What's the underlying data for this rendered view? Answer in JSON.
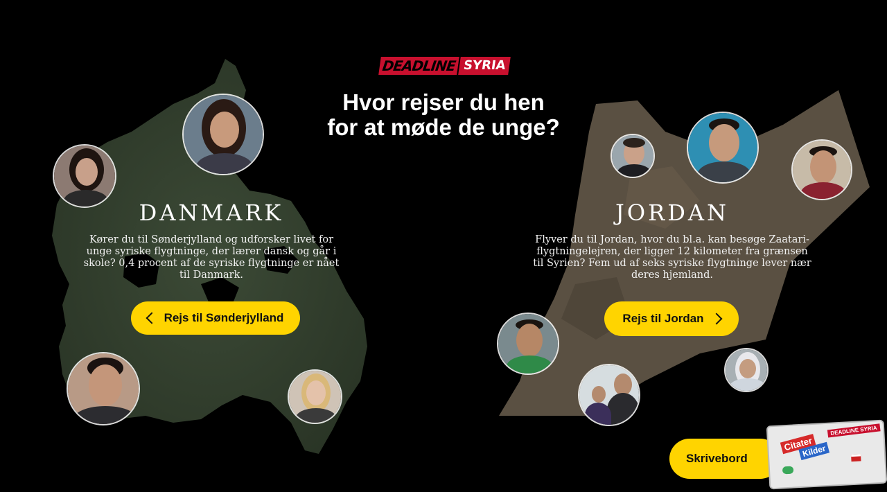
{
  "logo": {
    "part1": "DEADLINE",
    "part2": "SYRIA"
  },
  "headline": {
    "line1": "Hvor rejser du hen",
    "line2": "for at møde de unge?"
  },
  "denmark": {
    "title": "DANMARK",
    "lines": [
      "Kører du til Sønderjylland og udforsker livet for",
      "unge syriske flygtninge, der lærer dansk og går i",
      "skole? 0,4 procent af de syriske flygtninge er nået",
      "til Danmark."
    ],
    "button": "Rejs til Sønderjylland"
  },
  "jordan": {
    "title": "JORDAN",
    "lines": [
      "Flyver du til Jordan, hvor du bl.a. kan besøge Zaatari-",
      "flygtningelejren, der ligger 12 kilometer fra grænsen",
      "til Syrien? Fem ud af seks syriske flygtninge lever nær",
      "deres hjemland."
    ],
    "button": "Rejs til Jordan"
  },
  "desk": {
    "button": "Skrivebord",
    "sticker_citater": "Citater",
    "sticker_kilder": "Kilder",
    "sticker_logo": "DEADLINE SYRIA"
  },
  "colors": {
    "accent_yellow": "#ffd400",
    "brand_red": "#c8102e",
    "background": "#000000"
  }
}
